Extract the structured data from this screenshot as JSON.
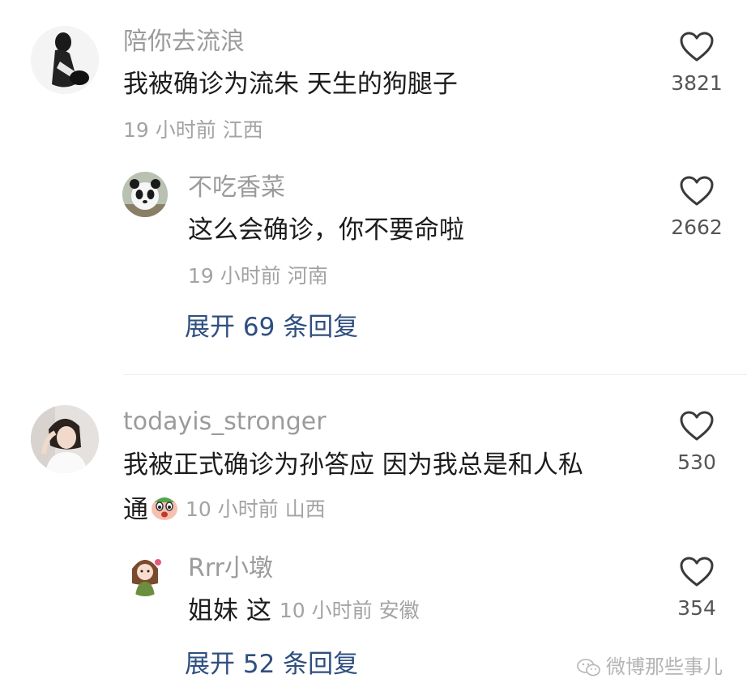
{
  "comments": [
    {
      "username": "陪你去流浪",
      "text": "我被确诊为流朱 天生的狗腿子",
      "time": "19 小时前",
      "location": "江西",
      "likes": "3821",
      "avatar_icon": "bw-portrait-avatar",
      "reply": {
        "username": "不吃香菜",
        "text": "这么会确诊，你不要命啦",
        "time": "19 小时前",
        "location": "河南",
        "likes": "2662",
        "avatar_icon": "panda-avatar"
      },
      "expand_label": "展开 69 条回复"
    },
    {
      "username": "todayis_stronger",
      "text_line1": "我被正式确诊为孙答应 因为我总是和人私",
      "text_line2": "通",
      "emoji_icon": "shocked-face-emoji",
      "time": "10 小时前",
      "location": "山西",
      "likes": "530",
      "avatar_icon": "girl-photo-avatar",
      "reply": {
        "username": "Rrr小墩",
        "text": "姐妹 这",
        "time": "10 小时前",
        "location": "安徽",
        "likes": "354",
        "avatar_icon": "cartoon-girl-avatar"
      },
      "expand_label": "展开 52 条回复"
    }
  ],
  "watermark": "微博那些事儿",
  "colors": {
    "link": "#2f4f80",
    "meta": "#a3a3a3",
    "text": "#1c1c1c"
  }
}
